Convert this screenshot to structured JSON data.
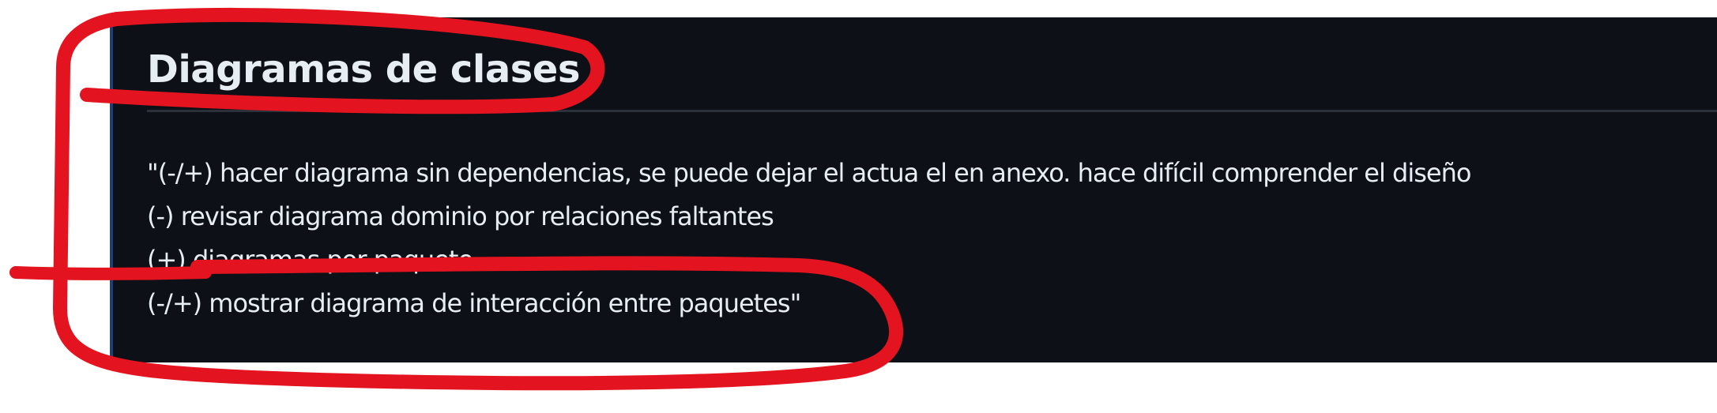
{
  "section": {
    "title": "Diagramas de clases",
    "lines": [
      "\"(-/+) hacer diagrama sin dependencias, se puede dejar el actua el en anexo. hace difícil comprender el diseño",
      "(-) revisar diagrama dominio por relaciones faltantes",
      "(+) diagramas por paquete",
      "(-/+) mostrar diagrama de interacción entre paquetes\""
    ]
  },
  "colors": {
    "panel_background": "#0d1017",
    "text": "#e6edf3",
    "divider": "#2b313a",
    "annotation_marker": "#e3141f"
  }
}
